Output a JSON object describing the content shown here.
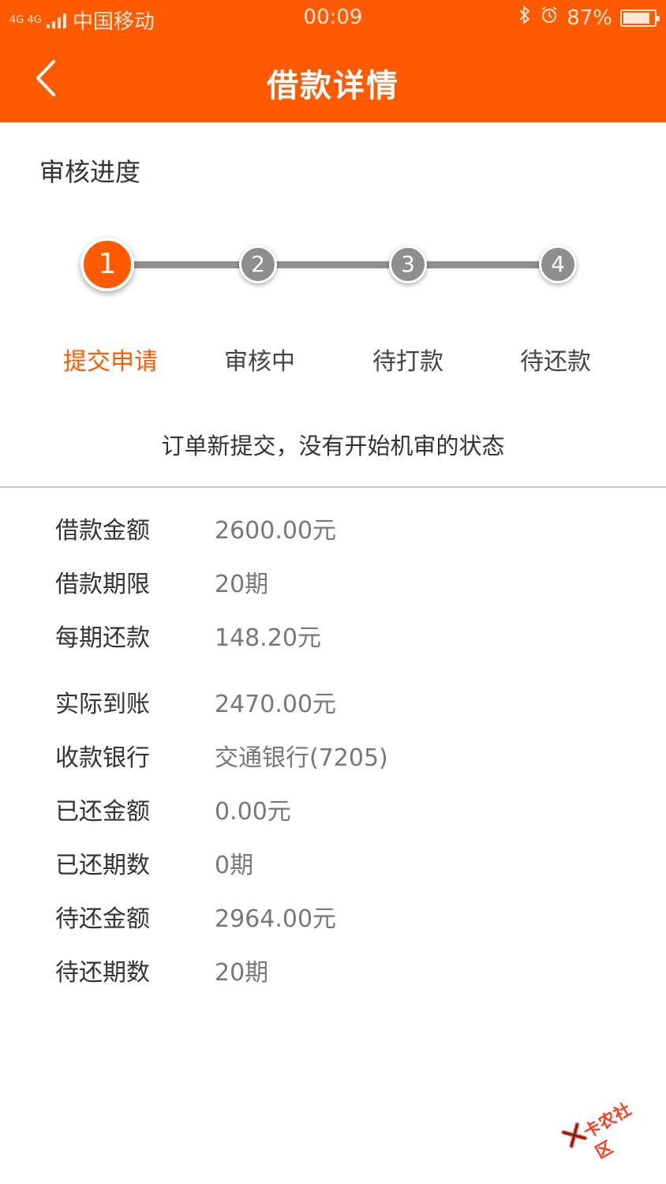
{
  "status_bar": {
    "network": "4G 4G",
    "carrier": "中国移动",
    "time": "00:09",
    "battery_text": "87%",
    "battery_level": 0.87,
    "icons": [
      "signal-icon",
      "bluetooth-icon",
      "alarm-icon",
      "battery-icon"
    ]
  },
  "header": {
    "title": "借款详情",
    "back_icon": "chevron-left-icon"
  },
  "progress": {
    "section_title": "审核进度",
    "current_step": 1,
    "steps": [
      {
        "number": "1",
        "label": "提交申请"
      },
      {
        "number": "2",
        "label": "审核中"
      },
      {
        "number": "3",
        "label": "待打款"
      },
      {
        "number": "4",
        "label": "待还款"
      }
    ],
    "message": "订单新提交，没有开始机审的状态"
  },
  "details": [
    {
      "label": "借款金额",
      "value": "2600.00元"
    },
    {
      "label": "借款期限",
      "value": "20期"
    },
    {
      "label": "每期还款",
      "value": "148.20元"
    },
    {
      "label": "实际到账",
      "value": "2470.00元"
    },
    {
      "label": "收款银行",
      "value": "交通银行(7205)"
    },
    {
      "label": "已还金额",
      "value": "0.00元"
    },
    {
      "label": "已还期数",
      "value": "0期"
    },
    {
      "label": "待还金额",
      "value": "2964.00元"
    },
    {
      "label": "待还期数",
      "value": "20期"
    }
  ],
  "watermark": {
    "text": "卡农社区"
  },
  "colors": {
    "brand": "#ff5a00",
    "inactive_step": "#8e8e8e"
  }
}
